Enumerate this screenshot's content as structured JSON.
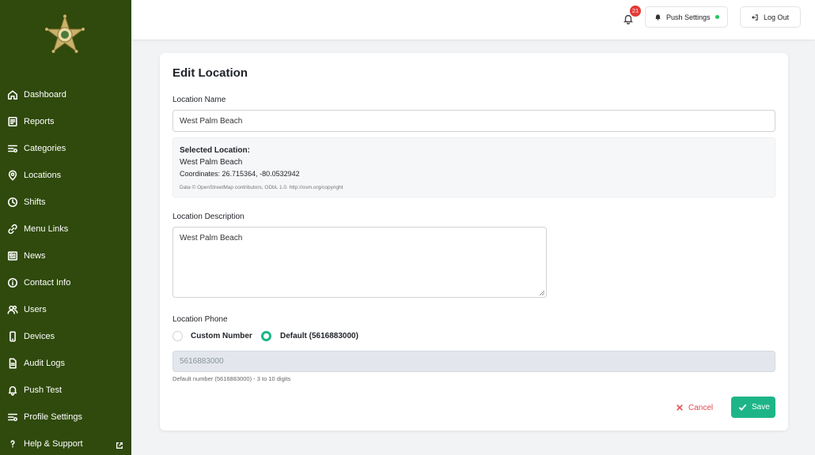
{
  "colors": {
    "sidebar_bg": "#2f4a0c",
    "accent": "#1db588",
    "danger": "#e5484d",
    "badge": "#e53935",
    "status_online": "#22c55e"
  },
  "sidebar": {
    "logo_icon": "sheriff-star-badge",
    "items": [
      {
        "label": "Dashboard",
        "icon": "home-icon"
      },
      {
        "label": "Reports",
        "icon": "reports-icon"
      },
      {
        "label": "Categories",
        "icon": "categories-icon"
      },
      {
        "label": "Locations",
        "icon": "map-pin-icon"
      },
      {
        "label": "Shifts",
        "icon": "clock-icon"
      },
      {
        "label": "Menu Links",
        "icon": "link-icon"
      },
      {
        "label": "News",
        "icon": "newspaper-icon"
      },
      {
        "label": "Contact Info",
        "icon": "info-icon"
      },
      {
        "label": "Users",
        "icon": "users-icon"
      },
      {
        "label": "Devices",
        "icon": "device-icon"
      },
      {
        "label": "Audit Logs",
        "icon": "document-icon"
      },
      {
        "label": "Push Test",
        "icon": "bell-icon"
      },
      {
        "label": "Profile Settings",
        "icon": "settings-icon"
      },
      {
        "label": "Help & Support",
        "icon": "question-icon"
      }
    ]
  },
  "header": {
    "notification_count": "21",
    "push_settings_label": "Push Settings",
    "logout_label": "Log Out"
  },
  "form": {
    "title": "Edit Location",
    "name_label": "Location Name",
    "name_value": "West Palm Beach",
    "selected": {
      "heading": "Selected Location:",
      "name": "West Palm Beach",
      "coordinates": "Coordinates: 26.715364, -80.0532942",
      "attribution": "Data © OpenStreetMap contributors, ODbL 1.0. http://osm.org/copyright"
    },
    "description_label": "Location Description",
    "description_value": "West Palm Beach",
    "phone_label": "Location Phone",
    "phone_options": [
      {
        "label": "Custom Number",
        "selected": false
      },
      {
        "label": "Default (5616883000)",
        "selected": true
      }
    ],
    "phone_value": "5616883000",
    "phone_hint": "Default number (5616883000) - 3 to 10 digits",
    "cancel_label": "Cancel",
    "save_label": "Save"
  }
}
